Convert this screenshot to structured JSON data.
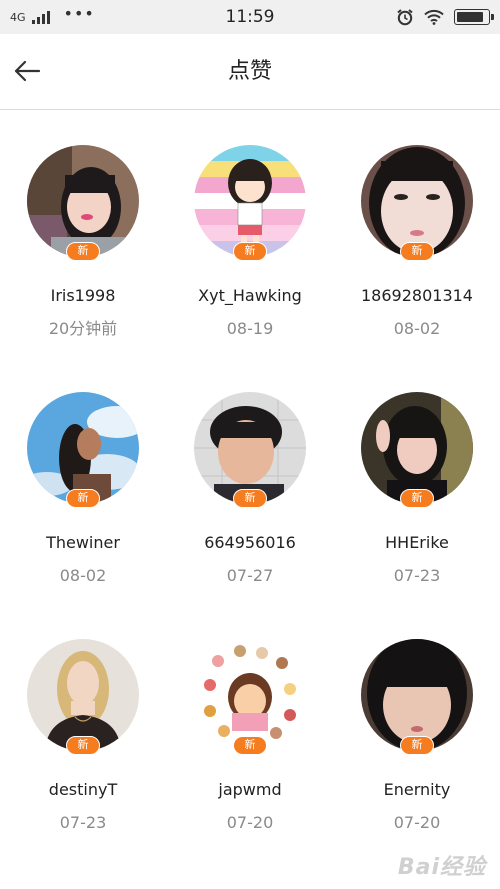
{
  "status_bar": {
    "network": "4G",
    "more": "•••",
    "time": "11:59"
  },
  "header": {
    "title": "点赞"
  },
  "badge_label": "新",
  "users": [
    {
      "name": "Iris1998",
      "time": "20分钟前",
      "avatar_icon": "girl-selfie-avatar"
    },
    {
      "name": "Xyt_Hawking",
      "time": "08-19",
      "avatar_icon": "cartoon-girl-avatar"
    },
    {
      "name": "18692801314",
      "time": "08-02",
      "avatar_icon": "girl-closeup-avatar"
    },
    {
      "name": "Thewiner",
      "time": "08-02",
      "avatar_icon": "sky-portrait-avatar"
    },
    {
      "name": "664956016",
      "time": "07-27",
      "avatar_icon": "boy-selfie-avatar"
    },
    {
      "name": "HHErike",
      "time": "07-23",
      "avatar_icon": "peace-sign-avatar"
    },
    {
      "name": "destinyT",
      "time": "07-23",
      "avatar_icon": "blonde-woman-avatar"
    },
    {
      "name": "japwmd",
      "time": "07-20",
      "avatar_icon": "emoji-food-avatar"
    },
    {
      "name": "Enernity",
      "time": "07-20",
      "avatar_icon": "girl-bangs-avatar"
    }
  ],
  "watermark": "Bai经验",
  "colors": {
    "badge": "#f57c1f",
    "divider": "#dcdcdc",
    "status_bar_bg": "#f0f0f0",
    "time_text": "#8a8a8a"
  }
}
